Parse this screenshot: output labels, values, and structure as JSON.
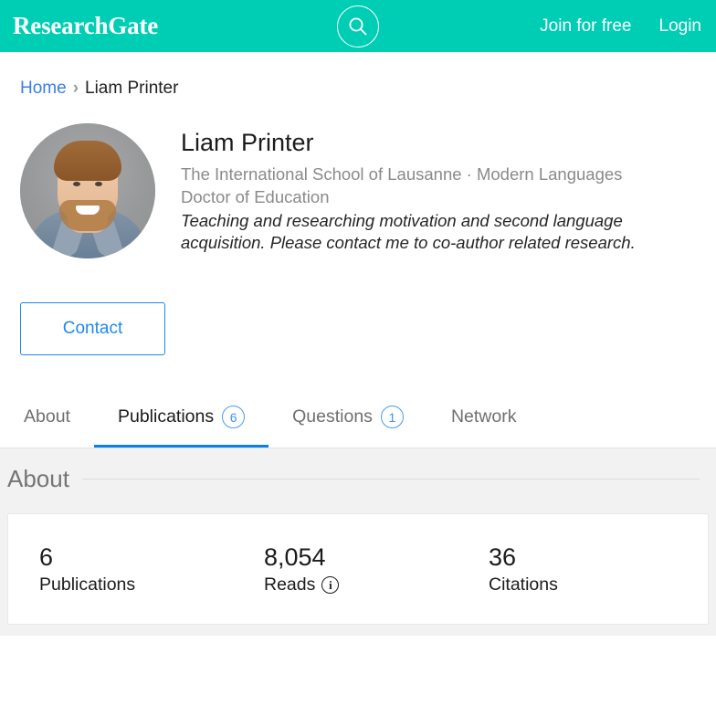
{
  "header": {
    "brand": "ResearchGate",
    "search_icon": "search-icon",
    "join_label": "Join for free",
    "login_label": "Login"
  },
  "breadcrumb": {
    "home": "Home",
    "separator": "›",
    "current": "Liam Printer"
  },
  "profile": {
    "avatar_alt": "Liam Printer profile photo",
    "name": "Liam Printer",
    "affiliation": "The International School of Lausanne · Modern Languages",
    "degree": "Doctor of Education",
    "bio": "Teaching and researching motivation and second language acquisition. Please contact me to co-author related research.",
    "contact_label": "Contact"
  },
  "tabs": [
    {
      "label": "About",
      "badge": null,
      "active": false
    },
    {
      "label": "Publications",
      "badge": "6",
      "active": true
    },
    {
      "label": "Questions",
      "badge": "1",
      "active": false
    },
    {
      "label": "Network",
      "badge": null,
      "active": false
    }
  ],
  "about": {
    "section_title": "About",
    "stats": [
      {
        "value": "6",
        "label": "Publications",
        "info": false
      },
      {
        "value": "8,054",
        "label": "Reads",
        "info": true
      },
      {
        "value": "36",
        "label": "Citations",
        "info": false
      }
    ]
  },
  "colors": {
    "brand_teal": "#00CEB4",
    "link_blue": "#3B7CEC",
    "accent_blue": "#0D7EEF",
    "section_bg": "#F2F2F2"
  }
}
